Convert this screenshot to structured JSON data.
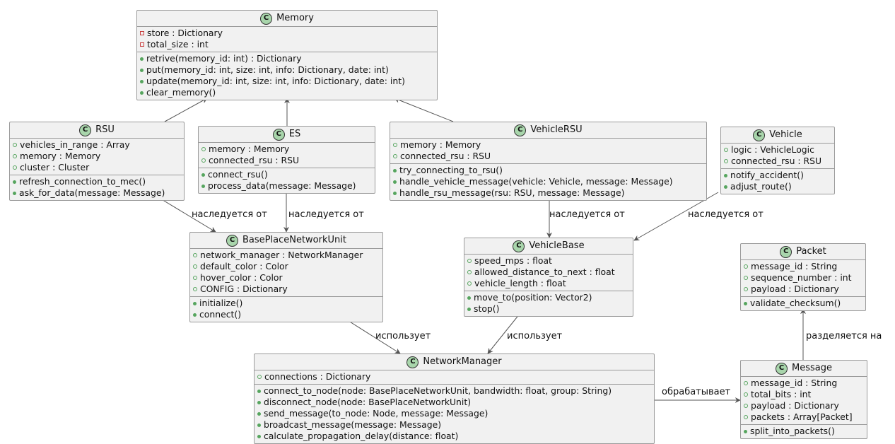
{
  "classes": {
    "memory": {
      "name": "Memory",
      "fields": [
        {
          "vis": "private",
          "text": "store : Dictionary"
        },
        {
          "vis": "private",
          "text": "total_size : int"
        }
      ],
      "methods": [
        {
          "vis": "public",
          "text": "retrive(memory_id: int) : Dictionary"
        },
        {
          "vis": "public",
          "text": "put(memory_id: int, size: int, info: Dictionary, date: int)"
        },
        {
          "vis": "public",
          "text": "update(memory_id: int, size: int, info: Dictionary, date: int)"
        },
        {
          "vis": "public",
          "text": "clear_memory()"
        }
      ]
    },
    "rsu": {
      "name": "RSU",
      "fields": [
        {
          "vis": "public_field",
          "text": "vehicles_in_range : Array"
        },
        {
          "vis": "public_field",
          "text": "memory : Memory"
        },
        {
          "vis": "public_field",
          "text": "cluster : Cluster"
        }
      ],
      "methods": [
        {
          "vis": "public",
          "text": "refresh_connection_to_mec()"
        },
        {
          "vis": "public",
          "text": "ask_for_data(message: Message)"
        }
      ]
    },
    "es": {
      "name": "ES",
      "fields": [
        {
          "vis": "public_field",
          "text": "memory : Memory"
        },
        {
          "vis": "public_field",
          "text": "connected_rsu : RSU"
        }
      ],
      "methods": [
        {
          "vis": "public",
          "text": "connect_rsu()"
        },
        {
          "vis": "public",
          "text": "process_data(message: Message)"
        }
      ]
    },
    "vehiclersu": {
      "name": "VehicleRSU",
      "fields": [
        {
          "vis": "public_field",
          "text": "memory : Memory"
        },
        {
          "vis": "public_field",
          "text": "connected_rsu : RSU"
        }
      ],
      "methods": [
        {
          "vis": "public",
          "text": "try_connecting_to_rsu()"
        },
        {
          "vis": "public",
          "text": "handle_vehicle_message(vehicle: Vehicle, message: Message)"
        },
        {
          "vis": "public",
          "text": "handle_rsu_message(rsu: RSU, message: Message)"
        }
      ]
    },
    "vehicle": {
      "name": "Vehicle",
      "fields": [
        {
          "vis": "public_field",
          "text": "logic : VehicleLogic"
        },
        {
          "vis": "public_field",
          "text": "connected_rsu : RSU"
        }
      ],
      "methods": [
        {
          "vis": "public",
          "text": "notify_accident()"
        },
        {
          "vis": "public",
          "text": "adjust_route()"
        }
      ]
    },
    "baseplace": {
      "name": "BasePlaceNetworkUnit",
      "fields": [
        {
          "vis": "public_field",
          "text": "network_manager : NetworkManager"
        },
        {
          "vis": "public_field",
          "text": "default_color : Color"
        },
        {
          "vis": "public_field",
          "text": "hover_color : Color"
        },
        {
          "vis": "public_field",
          "text": "CONFIG : Dictionary"
        }
      ],
      "methods": [
        {
          "vis": "public",
          "text": "initialize()"
        },
        {
          "vis": "public",
          "text": "connect()"
        }
      ]
    },
    "vehiclebase": {
      "name": "VehicleBase",
      "fields": [
        {
          "vis": "public_field",
          "text": "speed_mps : float"
        },
        {
          "vis": "public_field",
          "text": "allowed_distance_to_next : float"
        },
        {
          "vis": "public_field",
          "text": "vehicle_length : float"
        }
      ],
      "methods": [
        {
          "vis": "public",
          "text": "move_to(position: Vector2)"
        },
        {
          "vis": "public",
          "text": "stop()"
        }
      ]
    },
    "packet": {
      "name": "Packet",
      "fields": [
        {
          "vis": "public_field",
          "text": "message_id : String"
        },
        {
          "vis": "public_field",
          "text": "sequence_number : int"
        },
        {
          "vis": "public_field",
          "text": "payload : Dictionary"
        }
      ],
      "methods": [
        {
          "vis": "public",
          "text": "validate_checksum()"
        }
      ]
    },
    "networkmanager": {
      "name": "NetworkManager",
      "fields": [
        {
          "vis": "public_field",
          "text": "connections : Dictionary"
        }
      ],
      "methods": [
        {
          "vis": "public",
          "text": "connect_to_node(node: BasePlaceNetworkUnit, bandwidth: float, group: String)"
        },
        {
          "vis": "public",
          "text": "disconnect_node(node: BasePlaceNetworkUnit)"
        },
        {
          "vis": "public",
          "text": "send_message(to_node: Node, message: Message)"
        },
        {
          "vis": "public",
          "text": "broadcast_message(message: Message)"
        },
        {
          "vis": "public",
          "text": "calculate_propagation_delay(distance: float)"
        }
      ]
    },
    "message": {
      "name": "Message",
      "fields": [
        {
          "vis": "public_field",
          "text": "message_id : String"
        },
        {
          "vis": "public_field",
          "text": "total_bits : int"
        },
        {
          "vis": "public_field",
          "text": "payload : Dictionary"
        },
        {
          "vis": "public_field",
          "text": "packets : Array[Packet]"
        }
      ],
      "methods": [
        {
          "vis": "public",
          "text": "split_into_packets()"
        }
      ]
    }
  },
  "relations": {
    "rsu_to_base": "наследуется от",
    "es_to_base": "наследуется от",
    "vehiclersu_to_vehiclebase": "наследуется от",
    "vehicle_to_vehiclebase": "наследуется от",
    "base_to_nm": "использует",
    "vehiclebase_to_nm": "использует",
    "message_to_packet": "разделяется на",
    "nm_to_message": "обрабатывает"
  },
  "class_badge_letter": "C",
  "colors": {
    "class_fill": "#f1f1f1",
    "class_border": "#9a9a9a",
    "badge_fill": "#a8d5ab",
    "public_marker": "#56a55e",
    "private_marker": "#c83c3c",
    "edge": "#555555"
  }
}
